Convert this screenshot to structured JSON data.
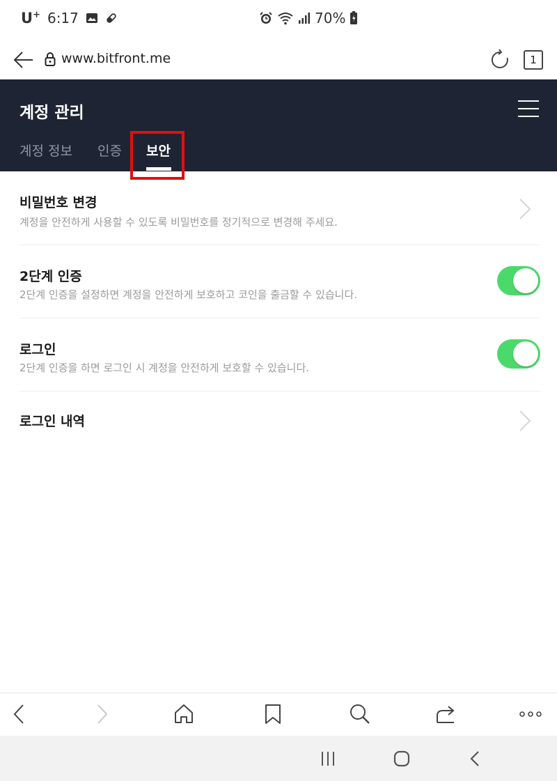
{
  "status_bar": {
    "carrier": "U",
    "carrier_sup": "+",
    "time": "6:17",
    "battery": "70%"
  },
  "address_bar": {
    "url": "www.bitfront.me",
    "tab_count": "1"
  },
  "header": {
    "title": "계정 관리",
    "tabs": [
      {
        "label": "계정 정보"
      },
      {
        "label": "인증"
      },
      {
        "label": "보안"
      }
    ],
    "active_tab": "보안"
  },
  "settings": [
    {
      "title": "비밀번호 변경",
      "description": "계정을 안전하게 사용할 수 있도록 비밀번호를 정기적으로 변경해 주세요.",
      "control": "chevron-right-icon"
    },
    {
      "title": "2단계 인증",
      "description": "2단계 인증을 설정하면 계정을 안전하게 보호하고 코인을 출금할 수 있습니다.",
      "control": "toggle",
      "enabled": true
    },
    {
      "title": "로그인",
      "description": "2단계 인증을 하면 로그인 시 계정을 안전하게 보호할 수 있습니다.",
      "control": "toggle",
      "enabled": true
    },
    {
      "title": "로그인 내역",
      "description": "",
      "control": "chevron-right-icon"
    }
  ],
  "toolbar_icons": [
    "back-icon",
    "forward-icon",
    "home-icon",
    "bookmark-icon",
    "search-icon",
    "share-icon",
    "more-icon"
  ],
  "nav_icons": [
    "recent-apps-icon",
    "home-icon",
    "back-icon"
  ],
  "colors": {
    "header_bg": "#1e2433",
    "toggle_on": "#4cd96b",
    "highlight": "#e01010",
    "tab_inactive": "#8f96a3"
  }
}
